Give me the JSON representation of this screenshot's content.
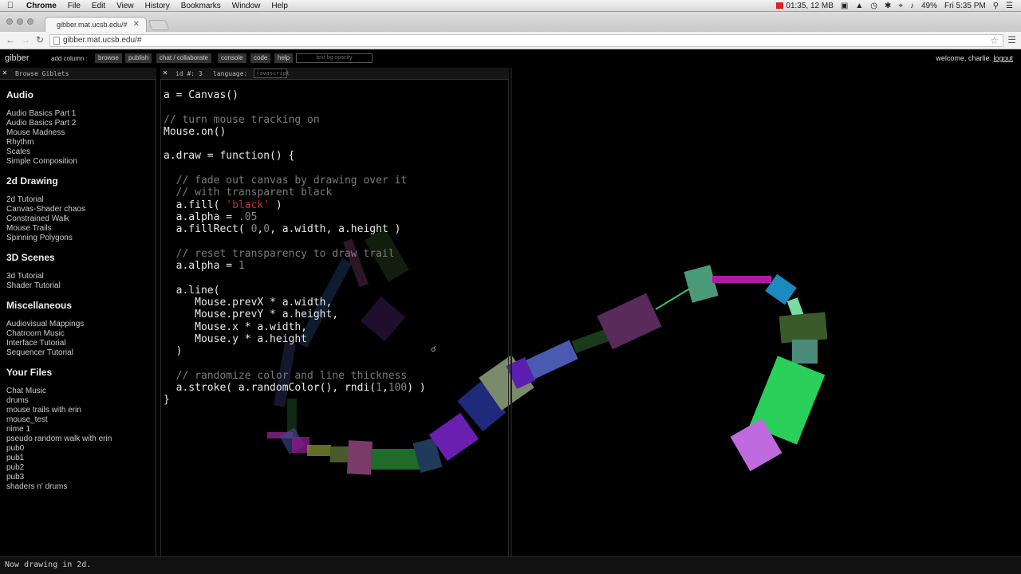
{
  "menubar": {
    "app": "Chrome",
    "items": [
      "File",
      "Edit",
      "View",
      "History",
      "Bookmarks",
      "Window",
      "Help"
    ],
    "status": "01:35, 12 MB",
    "battery": "49%",
    "day_time": "Fri 5:35 PM"
  },
  "browser": {
    "tab_title": "gibber.mat.ucsb.edu/#",
    "url": "gibber.mat.ucsb.edu/#"
  },
  "header": {
    "logo": "gibber",
    "add_column": "add column :",
    "buttons": [
      "browse",
      "publish",
      "chat / collaborate",
      "console",
      "code",
      "help"
    ],
    "text_bg_placeholder": "text bg opacity",
    "welcome": "welcome, charlie.",
    "logout": "logout"
  },
  "browse_column": {
    "title": "Browse Giblets",
    "sections": [
      {
        "title": "Audio",
        "items": [
          "Audio Basics Part 1",
          "Audio Basics Part 2",
          "Mouse Madness",
          "Rhythm",
          "Scales",
          "Simple Composition"
        ]
      },
      {
        "title": "2d Drawing",
        "items": [
          "2d Tutorial",
          "Canvas-Shader chaos",
          "Constrained Walk",
          "Mouse Trails",
          "Spinning Polygons"
        ]
      },
      {
        "title": "3D Scenes",
        "items": [
          "3d Tutorial",
          "Shader Tutorial"
        ]
      },
      {
        "title": "Miscellaneous",
        "items": [
          "Audiovisual Mappings",
          "Chatroom Music",
          "Interface Tutorial",
          "Sequencer Tutorial"
        ]
      },
      {
        "title": "Your Files",
        "items": [
          "Chat Music",
          "drums",
          "mouse trails with erin",
          "mouse_test",
          "nime 1",
          "pseudo random walk with erin",
          "pub0",
          "pub1",
          "pub2",
          "pub3",
          "shaders n' drums"
        ]
      }
    ]
  },
  "editor": {
    "id_label": "id #: 3",
    "language_label": "language:",
    "language_value": "javascript",
    "code_lines": [
      [
        {
          "t": "a = Canvas()"
        }
      ],
      [],
      [
        {
          "t": "// turn mouse tracking on",
          "c": "cm"
        }
      ],
      [
        {
          "t": "Mouse.on()"
        }
      ],
      [],
      [
        {
          "t": "a.draw = function() {"
        }
      ],
      [],
      [
        {
          "t": "  // fade out canvas by drawing over it",
          "c": "cm"
        }
      ],
      [
        {
          "t": "  // with transparent black",
          "c": "cm"
        }
      ],
      [
        {
          "t": "  a.fill( "
        },
        {
          "t": "'black'",
          "c": "str"
        },
        {
          "t": " )"
        }
      ],
      [
        {
          "t": "  a.alpha = "
        },
        {
          "t": ".05",
          "c": "num"
        }
      ],
      [
        {
          "t": "  a.fillRect( "
        },
        {
          "t": "0",
          "c": "num"
        },
        {
          "t": ","
        },
        {
          "t": "0",
          "c": "num"
        },
        {
          "t": ", a.width, a.height )"
        }
      ],
      [],
      [
        {
          "t": "  // reset transparency to draw trail",
          "c": "cm"
        }
      ],
      [
        {
          "t": "  a.alpha = "
        },
        {
          "t": "1",
          "c": "num"
        }
      ],
      [],
      [
        {
          "t": "  a.line("
        }
      ],
      [
        {
          "t": "     Mouse.prevX * a.width,"
        }
      ],
      [
        {
          "t": "     Mouse.prevY * a.height,"
        }
      ],
      [
        {
          "t": "     Mouse.x * a.width,"
        }
      ],
      [
        {
          "t": "     Mouse.y * a.height"
        }
      ],
      [
        {
          "t": "  )"
        }
      ],
      [],
      [
        {
          "t": "  // randomize color and line thickness",
          "c": "cm"
        }
      ],
      [
        {
          "t": "  a.stroke( a.randomColor(), rndi("
        },
        {
          "t": "1",
          "c": "num"
        },
        {
          "t": ","
        },
        {
          "t": "100",
          "c": "num"
        },
        {
          "t": ") )"
        }
      ],
      [
        {
          "t": "}"
        }
      ]
    ]
  },
  "status": "Now drawing in 2d."
}
